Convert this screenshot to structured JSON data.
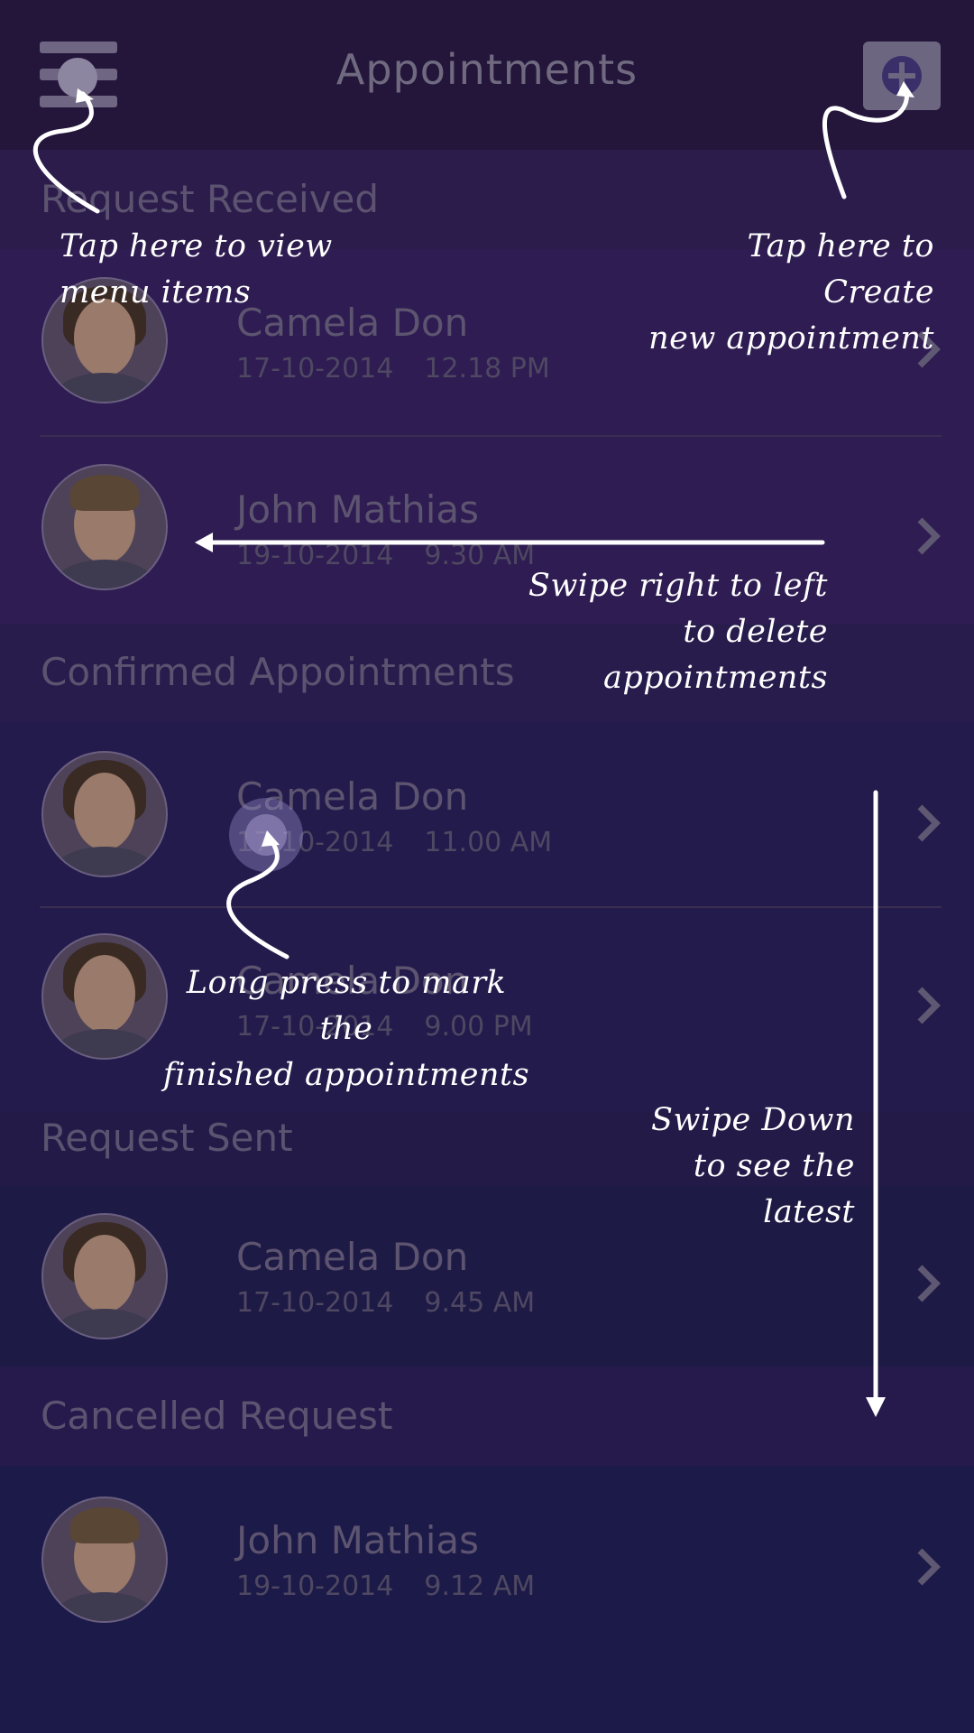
{
  "header": {
    "title": "Appointments",
    "menu_icon": "hamburger-menu-icon",
    "add_icon": "plus-icon"
  },
  "sections": [
    {
      "title": "Request Received",
      "items": [
        {
          "name": "Camela Don",
          "date": "17-10-2014",
          "time": "12.18 PM",
          "avatar": "female"
        },
        {
          "name": "John Mathias",
          "date": "19-10-2014",
          "time": "9.30 AM",
          "avatar": "male"
        }
      ]
    },
    {
      "title": "Confirmed Appointments",
      "items": [
        {
          "name": "Camela Don",
          "date": "17-10-2014",
          "time": "11.00 AM",
          "avatar": "female"
        },
        {
          "name": "Camela Don",
          "date": "17-10-2014",
          "time": "9.00 PM",
          "avatar": "female"
        }
      ]
    },
    {
      "title": "Request Sent",
      "items": [
        {
          "name": "Camela Don",
          "date": "17-10-2014",
          "time": "9.45 AM",
          "avatar": "female"
        }
      ]
    },
    {
      "title": "Cancelled Request",
      "items": [
        {
          "name": "John Mathias",
          "date": "19-10-2014",
          "time": "9.12 AM",
          "avatar": "male"
        }
      ]
    }
  ],
  "hints": {
    "menu": [
      "Tap here to view",
      "menu items"
    ],
    "create": [
      "Tap here to Create",
      "new appointment"
    ],
    "swipe_left": [
      "Swipe right to left",
      "to delete appointments"
    ],
    "long_press": [
      "Long press to mark the",
      "finished appointments"
    ],
    "swipe_down": [
      "Swipe Down",
      "to see the latest"
    ]
  },
  "colors": {
    "background": "#221a48",
    "header": "#24153a",
    "overlay_text": "#ffffff"
  }
}
